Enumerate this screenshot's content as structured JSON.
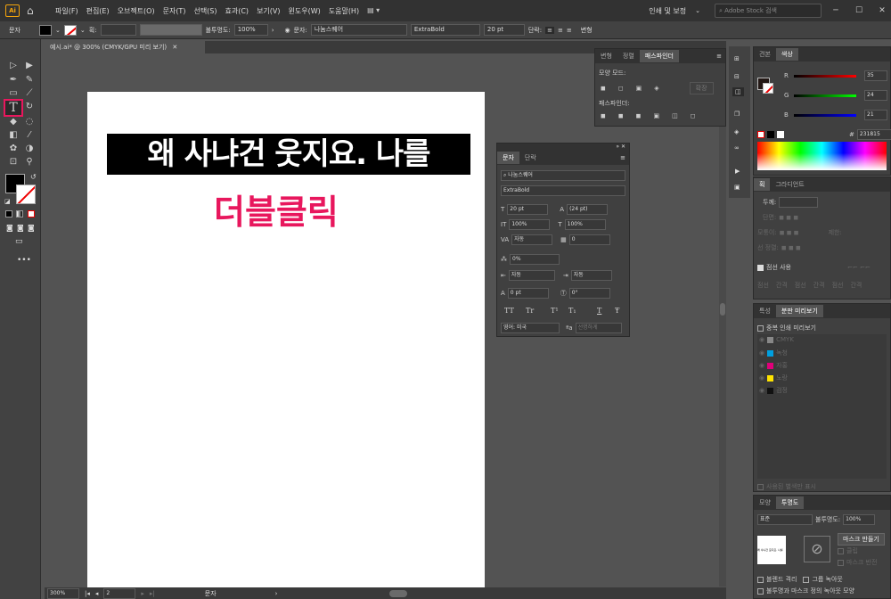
{
  "menubar": {
    "logo": "Ai",
    "menus": [
      "파일(F)",
      "편집(E)",
      "오브젝트(O)",
      "문자(T)",
      "선택(S)",
      "효과(C)",
      "보기(V)",
      "윈도우(W)",
      "도움말(H)"
    ],
    "workspace": "인쇄 및 보정",
    "stock_placeholder": "Adobe Stock 검색",
    "win_min": "─",
    "win_max": "☐",
    "win_close": "✕"
  },
  "controlbar": {
    "label": "문자",
    "stroke_label": "획:",
    "opacity_label": "불투명도:",
    "opacity": "100%",
    "char_label": "문자:",
    "font": "나눔스퀘어",
    "style": "ExtraBold",
    "size": "20 pt",
    "para_label": "단락:",
    "transform_label": "변형"
  },
  "document": {
    "tab": "예시.ai* @ 300% (CMYK/GPU 미리 보기)",
    "text_highlighted": "왜 사냐건 웃지요. 나를",
    "text_pink": "더블클릭"
  },
  "colors": {
    "pink": "#e8175d",
    "tool_highlight": "#e8175d"
  },
  "pathfinder": {
    "tabs": [
      "변형",
      "정렬",
      "패스파인더"
    ],
    "shape_modes_label": "모양 모드:",
    "expand_label": "확장",
    "pathfinders_label": "패스파인더:"
  },
  "character": {
    "tabs": [
      "문자",
      "단락"
    ],
    "font": "나눔스퀘어",
    "style": "ExtraBold",
    "size": "20 pt",
    "leading": "(24 pt)",
    "vscale": "100%",
    "hscale": "100%",
    "kerning": "자동",
    "tracking": "0",
    "tsume": "0%",
    "aki_left": "자동",
    "aki_right": "자동",
    "baseline": "0 pt",
    "rotation": "0°",
    "language": "영어: 미국",
    "antialias": "선명하게",
    "style_buttons": [
      "TT",
      "Tr",
      "T¹",
      "T₁",
      "T",
      "Ŧ"
    ]
  },
  "color_panel": {
    "tabs": [
      "견본",
      "색상"
    ],
    "r_label": "R",
    "r": "35",
    "g_label": "G",
    "g": "24",
    "b_label": "B",
    "b": "21",
    "hex_label": "#",
    "hex": "231815"
  },
  "stroke_panel": {
    "tabs": [
      "획",
      "그라디언트"
    ],
    "weight_label": "두께:",
    "cap_label": "단면:",
    "corner_label": "모퉁이:",
    "limit_label": "제한:",
    "align_label": "선 정렬:",
    "dashed_label": "점선 사용",
    "dash_cells": [
      "점선",
      "간격",
      "점선",
      "간격",
      "점선",
      "간격"
    ]
  },
  "separations": {
    "tabs": [
      "특성",
      "분판 미리보기"
    ],
    "overprint_label": "중복 인쇄 미리보기",
    "inks": [
      {
        "name": "CMYK",
        "color": "#888888"
      },
      {
        "name": "녹청",
        "color": "#00a0e0"
      },
      {
        "name": "자홍",
        "color": "#e0007a"
      },
      {
        "name": "노랑",
        "color": "#ffe400"
      },
      {
        "name": "검정",
        "color": "#111111"
      }
    ],
    "used_label": "사용된 별색만 표시"
  },
  "transparency": {
    "tabs": [
      "모양",
      "투명도"
    ],
    "mode": "표준",
    "opacity_label": "불투명도:",
    "opacity": "100%",
    "make_mask": "마스크 만들기",
    "clip": "클립",
    "invert": "마스크 반전",
    "isolate": "블렌드 격리",
    "knockout": "그룹 녹아웃",
    "opacity_mask": "불투명과 마스크 정의 녹아웃 모양",
    "thumb_text": "왜 사냐건 웃지요. 나를"
  },
  "statusbar": {
    "zoom": "300%",
    "page": "2",
    "tool": "문자"
  }
}
